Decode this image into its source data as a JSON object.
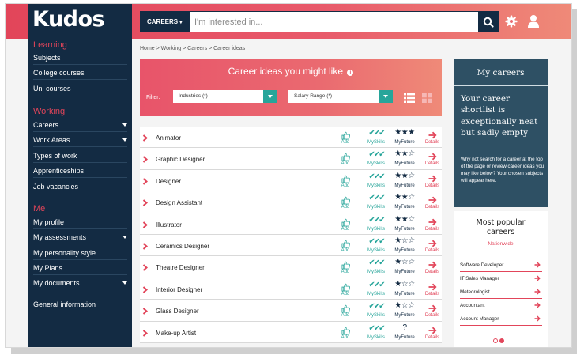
{
  "brand": "Kudos",
  "sidebar": {
    "sections": [
      {
        "title": "Learning",
        "items": [
          {
            "label": "Subjects",
            "caret": false
          },
          {
            "label": "College courses",
            "caret": false
          },
          {
            "label": "Uni courses",
            "caret": false
          }
        ]
      },
      {
        "title": "Working",
        "items": [
          {
            "label": "Careers",
            "caret": true
          },
          {
            "label": "Work Areas",
            "caret": true
          },
          {
            "label": "Types of work",
            "caret": false
          },
          {
            "label": "Apprenticeships",
            "caret": false
          },
          {
            "label": "Job vacancies",
            "caret": false
          }
        ]
      },
      {
        "title": "Me",
        "items": [
          {
            "label": "My profile",
            "caret": false
          },
          {
            "label": "My assessments",
            "caret": true
          },
          {
            "label": "My personality style",
            "caret": false
          },
          {
            "label": "My Plans",
            "caret": false
          },
          {
            "label": "My documents",
            "caret": true
          }
        ]
      }
    ],
    "general": "General information"
  },
  "search": {
    "category": "CAREERS",
    "category_suffix": "▾",
    "placeholder": "I'm interested in..."
  },
  "breadcrumb": {
    "trail": "Home > Working > Careers > ",
    "current": "Career ideas"
  },
  "ideas": {
    "title": "Career ideas you might like",
    "info_glyph": "i",
    "filter_label": "Filter:",
    "filter_industries": "Industries (*)",
    "filter_salary": "Salary Range (*)"
  },
  "labels": {
    "add": "Add",
    "myskills": "MySkills",
    "myfuture": "MyFuture",
    "details": "Details"
  },
  "careers": [
    {
      "name": "Animator",
      "skills": 3,
      "future_stars": 3,
      "future_known": true
    },
    {
      "name": "Graphic Designer",
      "skills": 3,
      "future_stars": 2,
      "future_known": true
    },
    {
      "name": "Designer",
      "skills": 3,
      "future_stars": 2,
      "future_known": true
    },
    {
      "name": "Design Assistant",
      "skills": 3,
      "future_stars": 2,
      "future_known": true
    },
    {
      "name": "Illustrator",
      "skills": 3,
      "future_stars": 2,
      "future_known": true
    },
    {
      "name": "Ceramics Designer",
      "skills": 3,
      "future_stars": 1,
      "future_known": true
    },
    {
      "name": "Theatre Designer",
      "skills": 3,
      "future_stars": 1,
      "future_known": true
    },
    {
      "name": "Interior Designer",
      "skills": 3,
      "future_stars": 1,
      "future_known": true
    },
    {
      "name": "Glass Designer",
      "skills": 3,
      "future_stars": 1,
      "future_known": true
    },
    {
      "name": "Make-up Artist",
      "skills": 3,
      "future_stars": 0,
      "future_known": false
    }
  ],
  "my_careers": {
    "title": "My careers",
    "headline": "Your career shortlist is exceptionally neat but sadly empty",
    "body": "Why not search for a career at the top of the page or review career ideas you may like below? Your chosen subjects will appear here."
  },
  "popular": {
    "title_line1": "Most popular",
    "title_line2": "careers",
    "scope": "Nationwide",
    "items": [
      "Software Developer",
      "IT Sales Manager",
      "Meteorologist",
      "Accountant",
      "Account Manager"
    ]
  },
  "colors": {
    "brand_pink": "#e2455a",
    "navy": "#132b43",
    "teal": "#27a59a",
    "slate": "#2e5064"
  }
}
